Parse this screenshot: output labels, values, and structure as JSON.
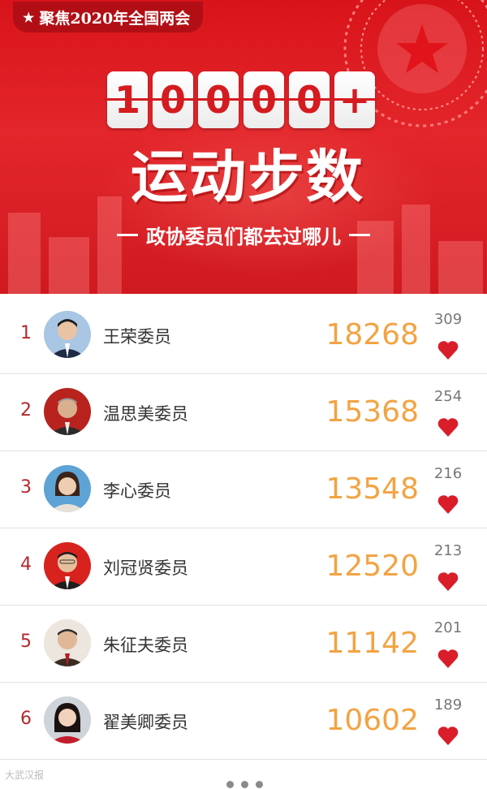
{
  "banner": {
    "tag_star": "★",
    "tag": "聚焦2020年全国两会",
    "counter_digits": [
      "1",
      "0",
      "0",
      "0",
      "0",
      "+"
    ],
    "headline": "运动步数",
    "subtitle": "政协委员们都去过哪儿"
  },
  "rows": [
    {
      "rank": "1",
      "name": "王荣委员",
      "steps": "18268",
      "likes": "309"
    },
    {
      "rank": "2",
      "name": "温思美委员",
      "steps": "15368",
      "likes": "254"
    },
    {
      "rank": "3",
      "name": "李心委员",
      "steps": "13548",
      "likes": "216"
    },
    {
      "rank": "4",
      "name": "刘冠贤委员",
      "steps": "12520",
      "likes": "213"
    },
    {
      "rank": "5",
      "name": "朱征夫委员",
      "steps": "11142",
      "likes": "201"
    },
    {
      "rank": "6",
      "name": "翟美卿委员",
      "steps": "10602",
      "likes": "189"
    }
  ],
  "footer": {
    "watermark": "大武汉报"
  },
  "colors": {
    "banner_red": "#d8141a",
    "steps_orange": "#f3a343",
    "heart_red": "#d91e2a",
    "rank_red": "#b3282d"
  },
  "icons": {
    "heart": "heart-icon",
    "star": "star-icon",
    "avatar": "avatar"
  }
}
